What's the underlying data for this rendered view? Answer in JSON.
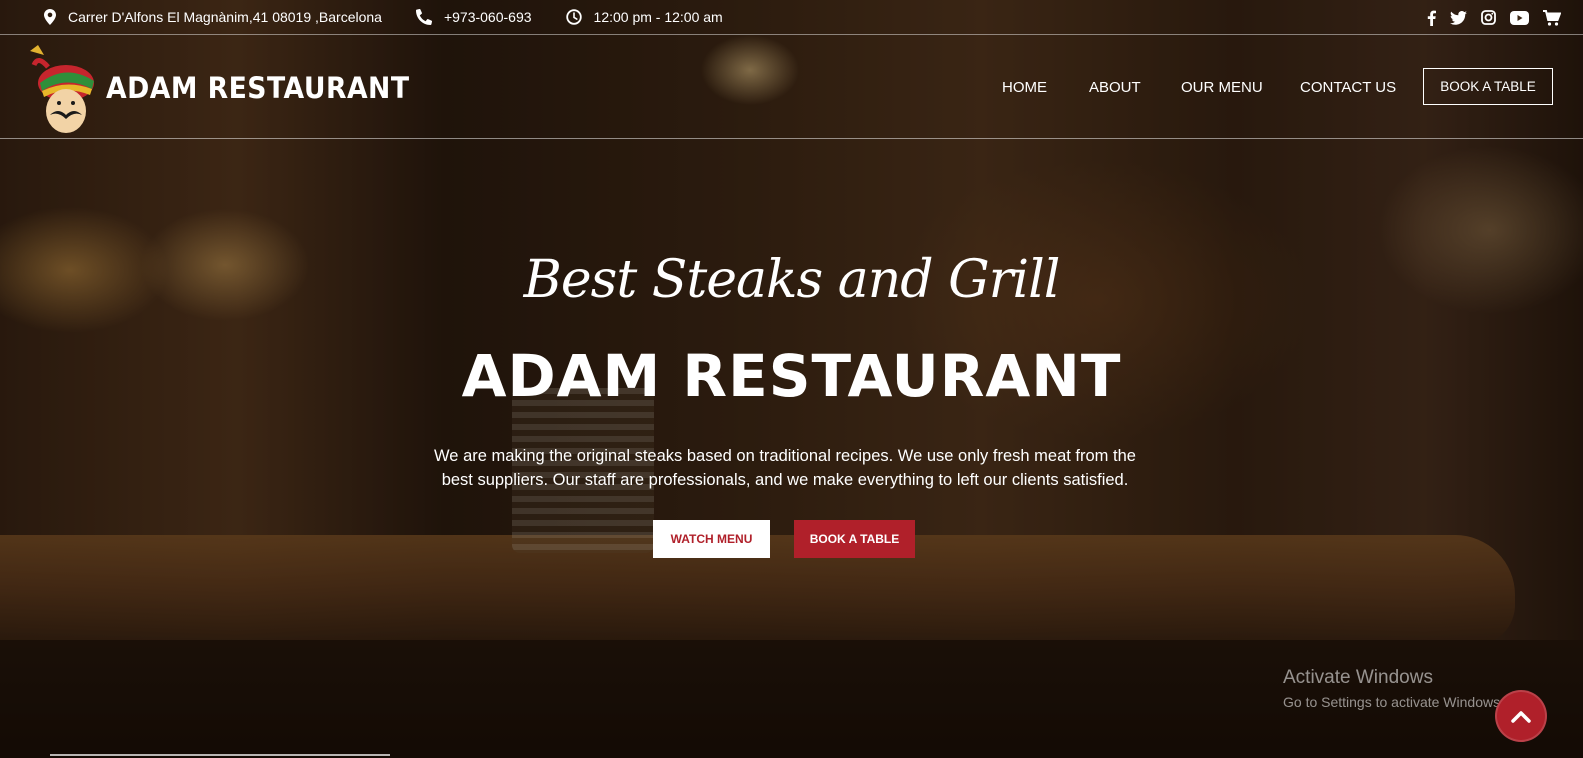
{
  "topbar": {
    "address": "Carrer D'Alfons El Magnànim,41 08019 ,Barcelona",
    "phone": "+973-060-693",
    "hours": "12:00 pm - 12:00 am",
    "social_icons": [
      "facebook-icon",
      "twitter-icon",
      "instagram-icon",
      "youtube-icon",
      "cart-icon"
    ]
  },
  "header": {
    "brand": "ADAM RESTAURANT",
    "nav": [
      "HOME",
      "ABOUT",
      "OUR MENU",
      "CONTACT US"
    ],
    "book_label": "BOOK A TABLE"
  },
  "hero": {
    "script": "Best Steaks and Grill",
    "title": "ADAM RESTAURANT",
    "description": "We are making the original steaks based on traditional recipes. We use only fresh meat from the best suppliers. Our staff are professionals, and we make everything to left our clients satisfied.",
    "watch_label": "WATCH MENU",
    "book_label": "BOOK A TABLE"
  },
  "overlay": {
    "activate_title": "Activate Windows",
    "activate_sub": "Go to Settings to activate Windows."
  },
  "colors": {
    "accent": "#b0202a",
    "text": "#ffffff"
  }
}
